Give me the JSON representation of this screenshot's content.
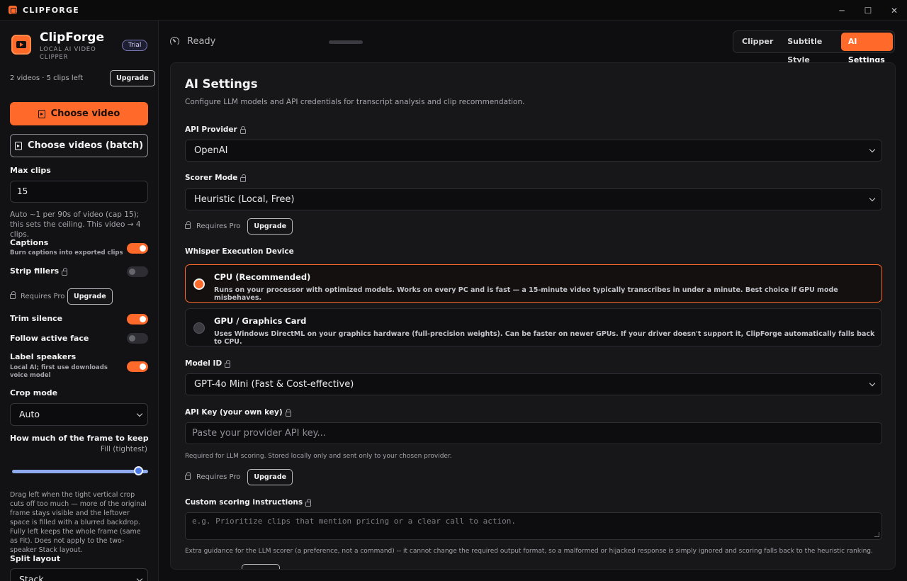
{
  "window": {
    "title": "CLIPFORGE",
    "controls": {
      "minimize": "─",
      "maximize": "☐",
      "close": "✕"
    }
  },
  "sidebar": {
    "brand_name": "ClipForge",
    "brand_sub": "LOCAL AI VIDEO CLIPPER",
    "plan_badge": "Trial",
    "usage": "2 videos · 5 clips left",
    "upgrade_label": "Upgrade",
    "choose_video": "Choose video",
    "choose_batch": "Choose videos (batch)",
    "max_clips_label": "Max clips",
    "max_clips_value": "15",
    "max_clips_help": "Auto ~1 per 90s of video (cap 15); this sets the ceiling. This video → 4 clips.",
    "toggles": [
      {
        "label": "Captions",
        "sub": "Burn captions into exported clips",
        "on": true
      },
      {
        "label": "Strip fillers",
        "sub": "",
        "on": false,
        "locked": true
      },
      {
        "label": "Trim silence",
        "sub": "",
        "on": true
      },
      {
        "label": "Follow active face",
        "sub": "",
        "on": false
      },
      {
        "label": "Label speakers",
        "sub": "Local AI; first use downloads voice model",
        "on": true
      }
    ],
    "requires_pro": "Requires Pro",
    "crop_mode_label": "Crop mode",
    "crop_mode_value": "Auto",
    "frame_keep_label": "How much of the frame to keep",
    "frame_keep_value": "Fill (tightest)",
    "frame_keep_fraction": 0.93,
    "frame_keep_help": "Drag left when the tight vertical crop cuts off too much — more of the original frame stays visible and the leftover space is filled with a blurred backdrop. Fully left keeps the whole frame (same as Fit). Does not apply to the two-speaker Stack layout.",
    "split_layout_label": "Split layout",
    "split_layout_value": "Stack"
  },
  "main": {
    "status": "Ready",
    "tabs": [
      {
        "label": "Clipper",
        "active": false
      },
      {
        "label": "Subtitle Style",
        "active": false
      },
      {
        "label": "AI Settings",
        "active": true
      }
    ],
    "panel": {
      "title": "AI Settings",
      "description": "Configure LLM models and API credentials for transcript analysis and clip recommendation.",
      "api_provider_label": "API Provider",
      "api_provider_value": "OpenAI",
      "scorer_mode_label": "Scorer Mode",
      "scorer_mode_value": "Heuristic (Local, Free)",
      "requires_pro": "Requires Pro",
      "upgrade_label": "Upgrade",
      "whisper_label": "Whisper Execution Device",
      "devices": [
        {
          "title": "CPU (Recommended)",
          "desc": "Runs on your processor with optimized models. Works on every PC and is fast — a 15-minute video typically transcribes in under a minute. Best choice if GPU mode misbehaves.",
          "selected": true
        },
        {
          "title": "GPU / Graphics Card",
          "desc": "Uses Windows DirectML on your graphics hardware (full-precision weights). Can be faster on newer GPUs. If your driver doesn't support it, ClipForge automatically falls back to CPU.",
          "selected": false
        }
      ],
      "model_id_label": "Model ID",
      "model_id_value": "GPT-4o Mini (Fast & Cost-effective)",
      "api_key_label": "API Key (your own key)",
      "api_key_placeholder": "Paste your provider API key...",
      "api_key_help": "Required for LLM scoring. Stored locally only and sent only to your chosen provider.",
      "custom_label": "Custom scoring instructions",
      "custom_placeholder": "e.g. Prioritize clips that mention pricing or a clear call to action.",
      "custom_help": "Extra guidance for the LLM scorer (a preference, not a command) -- it cannot change the required output format, so a malformed or hijacked response is simply ignored and scoring falls back to the heuristic ranking."
    }
  },
  "colors": {
    "accent": "#ff6a2a",
    "slider": "#4c7ae8",
    "background": "#0e0e10"
  }
}
